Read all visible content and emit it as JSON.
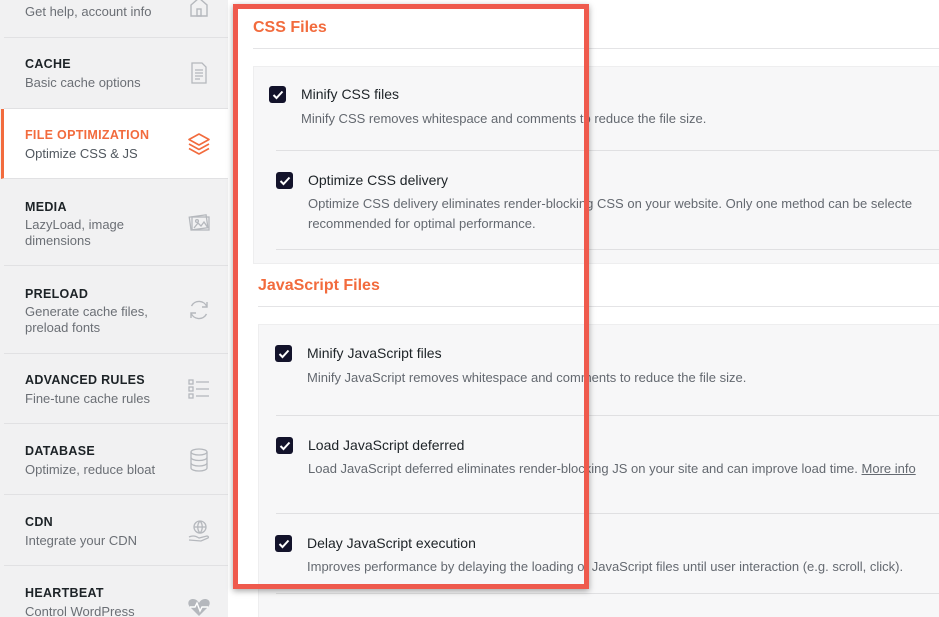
{
  "sidebar": {
    "items": [
      {
        "title": "",
        "sub": "Get help, account info",
        "icon": "home-icon"
      },
      {
        "title": "CACHE",
        "sub": "Basic cache options",
        "icon": "document-icon"
      },
      {
        "title": "FILE OPTIMIZATION",
        "sub": "Optimize CSS & JS",
        "icon": "layers-icon"
      },
      {
        "title": "MEDIA",
        "sub": "LazyLoad, image dimensions",
        "icon": "images-icon"
      },
      {
        "title": "PRELOAD",
        "sub": "Generate cache files, preload fonts",
        "icon": "refresh-icon"
      },
      {
        "title": "ADVANCED RULES",
        "sub": "Fine-tune cache rules",
        "icon": "list-icon"
      },
      {
        "title": "DATABASE",
        "sub": "Optimize, reduce bloat",
        "icon": "database-icon"
      },
      {
        "title": "CDN",
        "sub": "Integrate your CDN",
        "icon": "globe-hand-icon"
      },
      {
        "title": "HEARTBEAT",
        "sub": "Control WordPress",
        "icon": "heartbeat-icon"
      }
    ]
  },
  "css_section": {
    "title": "CSS Files",
    "options": [
      {
        "label": "Minify CSS files",
        "checked": true,
        "desc": "Minify CSS removes whitespace and comments to reduce the file size."
      },
      {
        "label": "Optimize CSS delivery",
        "checked": true,
        "desc": "Optimize CSS delivery eliminates render-blocking CSS on your website. Only one method can be selecte recommended for optimal performance."
      }
    ]
  },
  "js_section": {
    "title": "JavaScript Files",
    "options": [
      {
        "label": "Minify JavaScript files",
        "checked": true,
        "desc": "Minify JavaScript removes whitespace and comments to reduce the file size."
      },
      {
        "label": "Load JavaScript deferred",
        "checked": true,
        "desc": "Load JavaScript deferred eliminates render-blocking JS on your site and can improve load time.",
        "link": "More info"
      },
      {
        "label": "Delay JavaScript execution",
        "checked": true,
        "desc": "Improves performance by delaying the loading of JavaScript files until user interaction (e.g. scroll, click)."
      }
    ]
  },
  "colors": {
    "accent": "#f26b3d",
    "highlight": "#ef5a4d",
    "checkbox": "#13132b"
  }
}
